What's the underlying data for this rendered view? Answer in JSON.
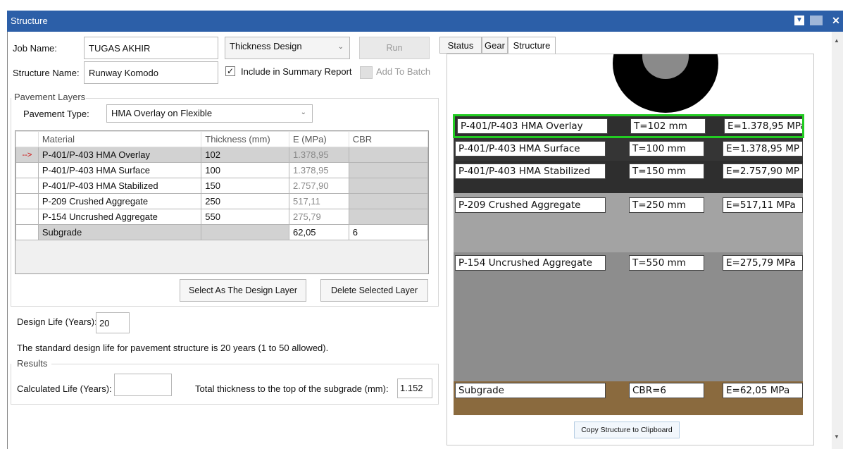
{
  "window": {
    "title": "Structure"
  },
  "form": {
    "job_name_label": "Job Name:",
    "job_name_value": "TUGAS AKHIR",
    "structure_name_label": "Structure Name:",
    "structure_name_value": "Runway Komodo",
    "design_mode_value": "Thickness Design",
    "run_label": "Run",
    "include_summary_label": "Include in Summary Report",
    "add_to_batch_label": "Add To Batch"
  },
  "pavement": {
    "group_label": "Pavement Layers",
    "type_label": "Pavement Type:",
    "type_value": "HMA Overlay on Flexible",
    "columns": [
      "Material",
      "Thickness (mm)",
      "E (MPa)",
      "CBR"
    ],
    "rows": [
      {
        "marker": "-->",
        "material": "P-401/P-403 HMA Overlay",
        "thickness": "102",
        "e": "1.378,95",
        "cbr": ""
      },
      {
        "marker": "",
        "material": "P-401/P-403 HMA Surface",
        "thickness": "100",
        "e": "1.378,95",
        "cbr": ""
      },
      {
        "marker": "",
        "material": "P-401/P-403 HMA Stabilized",
        "thickness": "150",
        "e": "2.757,90",
        "cbr": ""
      },
      {
        "marker": "",
        "material": "P-209 Crushed Aggregate",
        "thickness": "250",
        "e": "517,11",
        "cbr": ""
      },
      {
        "marker": "",
        "material": "P-154 Uncrushed Aggregate",
        "thickness": "550",
        "e": "275,79",
        "cbr": ""
      },
      {
        "marker": "",
        "material": "Subgrade",
        "thickness": "",
        "e": "62,05",
        "cbr": "6"
      }
    ],
    "select_design_label": "Select As The Design Layer",
    "delete_label": "Delete Selected Layer"
  },
  "design_life": {
    "label": "Design Life (Years):",
    "value": "20",
    "note": "The standard design life for pavement structure is 20 years (1 to 50 allowed)."
  },
  "results": {
    "group_label": "Results",
    "calc_life_label": "Calculated Life (Years):",
    "calc_life_value": "",
    "total_thickness_label": "Total thickness to the top of the subgrade (mm):",
    "total_thickness_value": "1.152"
  },
  "tabs": [
    "Status",
    "Gear",
    "Structure"
  ],
  "structure_view": {
    "layers": [
      {
        "name": "P-401/P-403 HMA Overlay",
        "t": "T=102 mm",
        "e": "E=1.378,95 MPa"
      },
      {
        "name": "P-401/P-403 HMA Surface",
        "t": "T=100 mm",
        "e": "E=1.378,95 MP"
      },
      {
        "name": "P-401/P-403 HMA Stabilized",
        "t": "T=150 mm",
        "e": "E=2.757,90 MP"
      },
      {
        "name": "P-209 Crushed Aggregate",
        "t": "T=250 mm",
        "e": "E=517,11 MPa"
      },
      {
        "name": "P-154 Uncrushed Aggregate",
        "t": "T=550 mm",
        "e": "E=275,79 MPa"
      },
      {
        "name": "Subgrade",
        "t": "CBR=6",
        "e": "E=62,05 MPa"
      }
    ],
    "copy_label": "Copy Structure to Clipboard",
    "colors": {
      "selected": "#22cc22",
      "asphalt": "#2a2a2a",
      "aggregate": "#8d8d8d",
      "subgrade": "#8a6a3e"
    }
  },
  "icons": [
    "dropdown-icon",
    "restore-icon",
    "close-icon",
    "check-icon",
    "row-pointer-icon",
    "wheel-icon",
    "scroll-up-icon",
    "scroll-down-icon"
  ]
}
